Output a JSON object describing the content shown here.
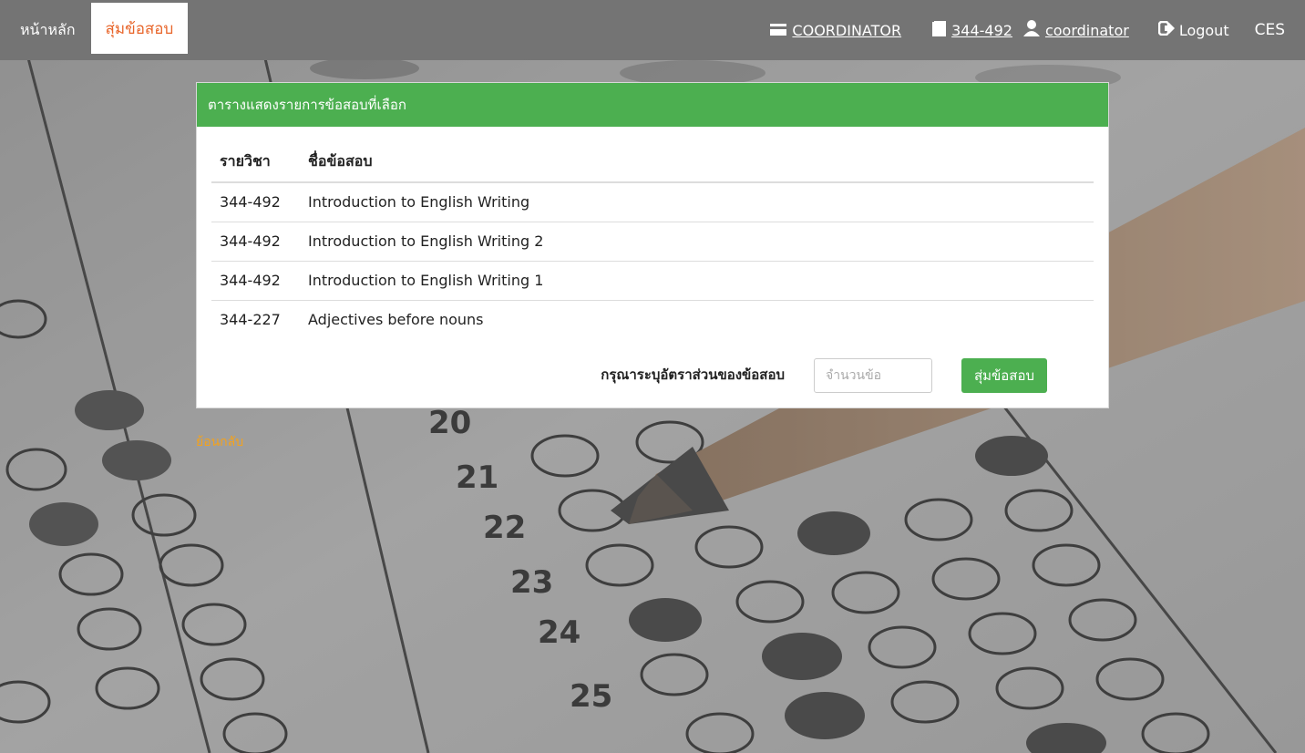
{
  "nav": {
    "home_label": "หน้าหลัก",
    "active_label": "สุ่มข้อสอบ",
    "role_label": "COORDINATOR",
    "course_label": "344-492",
    "user_label": "coordinator",
    "logout_label": "Logout",
    "brand_label": "CES"
  },
  "panel": {
    "title": "ตารางแสดงรายการข้อสอบที่เลือก",
    "columns": [
      "รายวิชา",
      "ชื่อข้อสอบ"
    ],
    "rows": [
      {
        "code": "344-492",
        "name": "Introduction to English Writing"
      },
      {
        "code": "344-492",
        "name": "Introduction to English Writing 2"
      },
      {
        "code": "344-492",
        "name": "Introduction to English Writing 1"
      },
      {
        "code": "344-227",
        "name": "Adjectives before nouns"
      }
    ],
    "form_label": "กรุณาระบุอัตราส่วนของข้อสอบ",
    "input_placeholder": "จำนวนข้อ",
    "input_value": "",
    "submit_label": "สุ่มข้อสอบ"
  },
  "back_label": "ย้อนกลับ",
  "colors": {
    "navbar": "#747474",
    "active_tab_text": "#e8652a",
    "panel_header": "#4caf50",
    "button": "#4caf50",
    "back_link": "#f4a21c"
  }
}
